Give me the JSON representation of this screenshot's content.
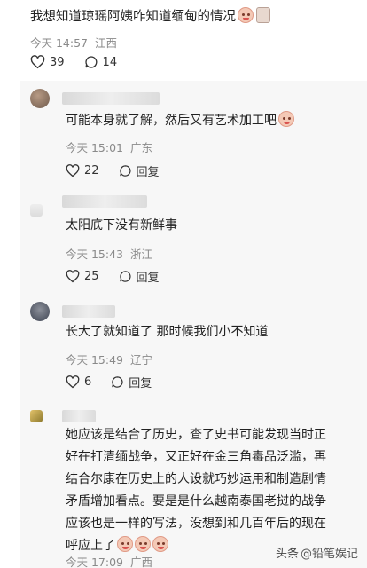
{
  "top_comment": {
    "text": "我想知道琼瑶阿姨咋知道缅甸的情况",
    "time": "今天 14:57",
    "location": "江西",
    "likes": "39",
    "comments": "14"
  },
  "replies": [
    {
      "text": "可能本身就了解，然后又有艺术加工吧",
      "time": "今天 15:01",
      "location": "广东",
      "likes": "22",
      "reply_label": "回复"
    },
    {
      "text": "太阳底下没有新鲜事",
      "time": "今天 15:43",
      "location": "浙江",
      "likes": "25",
      "reply_label": "回复"
    },
    {
      "text": "长大了就知道了 那时候我们小不知道",
      "time": "今天 15:49",
      "location": "辽宁",
      "likes": "6",
      "reply_label": "回复"
    },
    {
      "lines": [
        "她应该是结合了历史，查了史书可能发现当时正",
        "好在打清缅战争，又正好在金三角毒品泛滥，再",
        "结合尔康在历史上的人设就巧妙运用和制造剧情",
        "矛盾增加看点。要是是什么越南泰国老挝的战争",
        "应该也是一样的写法，没想到和几百年后的现在",
        "呼应上了"
      ],
      "time": "今天 17:09",
      "location": "广西"
    }
  ],
  "watermark": {
    "prefix": "头条",
    "account": "@铅笔娱记"
  }
}
